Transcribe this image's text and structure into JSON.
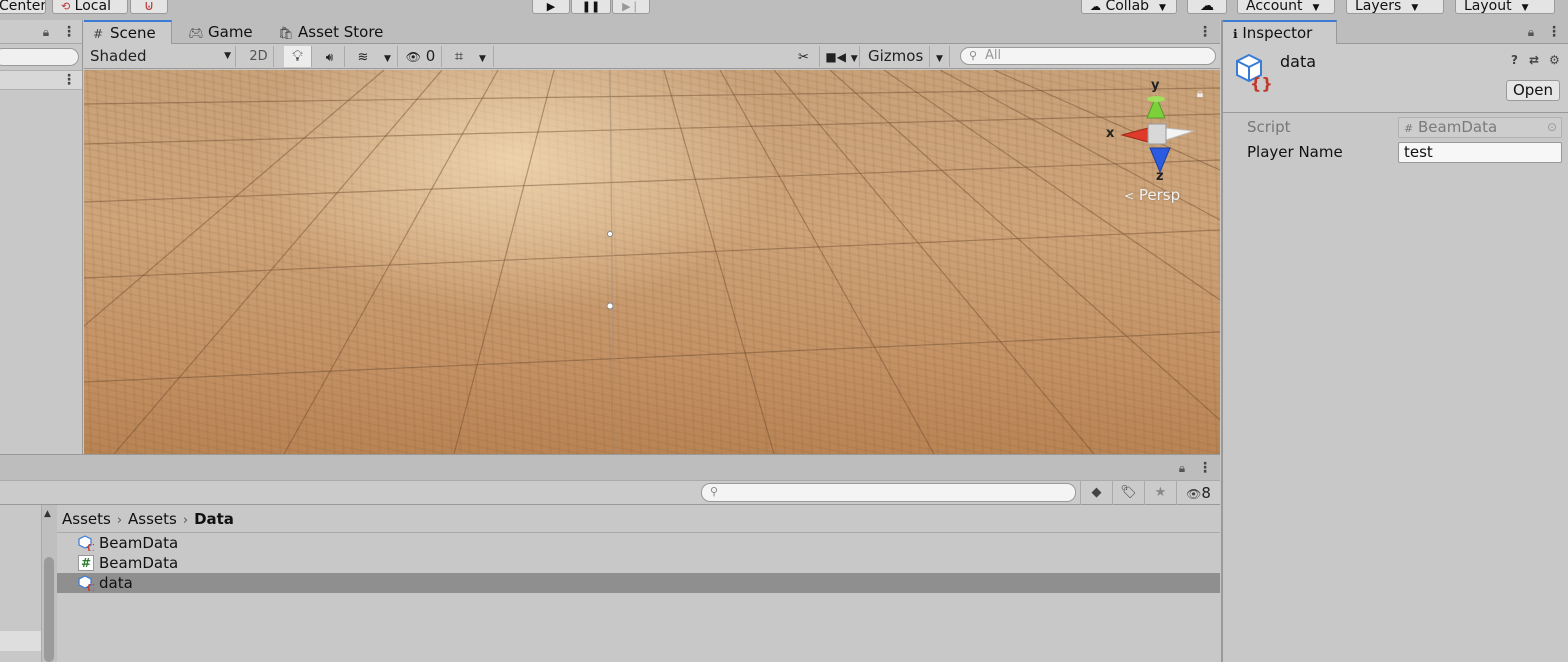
{
  "toolbar": {
    "center_label": "Center",
    "local_label": "Local",
    "collab_label": "Collab",
    "account_label": "Account",
    "layers_label": "Layers",
    "layout_label": "Layout"
  },
  "scene_tabs": [
    {
      "label": "Scene",
      "icon": "grid-icon",
      "active": true
    },
    {
      "label": "Game",
      "icon": "gamepad-icon",
      "active": false
    },
    {
      "label": "Asset Store",
      "icon": "shopping-bag-icon",
      "active": false
    }
  ],
  "scene_toolbar": {
    "shading_mode": "Shaded",
    "mode_2d": "2D",
    "hidden_count": "0",
    "gizmos_label": "Gizmos",
    "search_placeholder": "All"
  },
  "scene_gizmo": {
    "axis_y": "y",
    "axis_x": "x",
    "axis_z": "z",
    "projection": "Persp"
  },
  "project": {
    "breadcrumb": [
      "Assets",
      "Assets",
      "Data"
    ],
    "hidden_count": "8",
    "assets": [
      {
        "name": "BeamData",
        "type": "scriptable-object",
        "selected": false
      },
      {
        "name": "BeamData",
        "type": "script",
        "selected": false
      },
      {
        "name": "data",
        "type": "scriptable-object",
        "selected": true
      }
    ]
  },
  "inspector": {
    "tab_label": "Inspector",
    "object_name": "data",
    "open_label": "Open",
    "script_label": "Script",
    "script_value": "BeamData",
    "player_name_label": "Player Name",
    "player_name_value": "test"
  },
  "colors": {
    "accent": "#3a7bd5",
    "panel": "#c8c8c8",
    "selection": "#8f8f8f",
    "axis_x": "#e03a2a",
    "axis_y": "#7cd13a",
    "axis_z": "#2a5be0"
  }
}
